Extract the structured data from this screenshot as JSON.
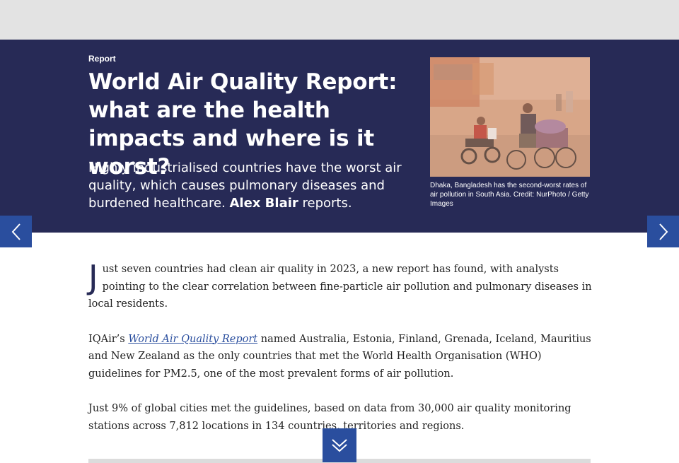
{
  "hero": {
    "category": "Report",
    "headline": "World Air Quality Report: what are the health impacts and where is it worst?",
    "standfirst_pre": "Highly industrialised countries have the worst air quality, which causes pulmonary diseases and burdened healthcare.",
    "author": "Alex Blair",
    "standfirst_post": "reports.",
    "image_caption": "Dhaka, Bangladesh has the second-worst rates of air pollution in South Asia. Credit: NurPhoto / Getty Images"
  },
  "nav": {
    "prev_icon": "chevron-left-icon",
    "next_icon": "chevron-right-icon",
    "scroll_icon": "double-chevron-down-icon"
  },
  "article": {
    "p1_dropcap": "J",
    "p1_rest": "ust seven countries had clean air quality in 2023, a new report has found, with analysts pointing to the clear correlation between fine-particle air pollution and pulmonary diseases in local residents.",
    "p2_pre": "IQAir’s",
    "p2_link": "World Air Quality Report",
    "p2_post": "named Australia, Estonia, Finland, Grenada, Iceland, Mauritius and New Zealand as the only countries that met the World Health Organisation (WHO) guidelines for PM2.5, one of the most prevalent forms of air pollution.",
    "p3": "Just 9% of global cities met the guidelines, based on data from 30,000 air quality monitoring stations across 7,812 locations in 134 countries, territories and regions."
  },
  "colors": {
    "hero_bg": "#272a56",
    "accent": "#2a4e9e",
    "top_bar": "#e3e3e3"
  }
}
